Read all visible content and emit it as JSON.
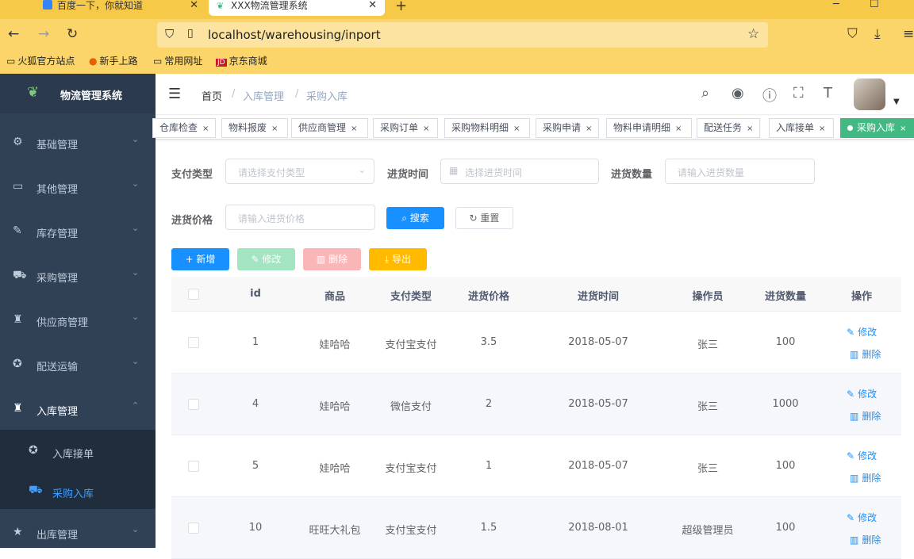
{
  "browser": {
    "tabs": [
      {
        "label": "百度一下，你就知道",
        "close": "✕"
      },
      {
        "label": "XXX物流管理系统",
        "close": "✕"
      }
    ],
    "new_tab": "+",
    "url_host": "localhost",
    "url_path": "/warehousing/inport",
    "bookmarks": [
      "火狐官方站点",
      "新手上路",
      "常用网址",
      "京东商城"
    ]
  },
  "app": {
    "title": "物流管理系统"
  },
  "sidebar": {
    "items": [
      {
        "label": "基础管理",
        "icon": "gear-icon"
      },
      {
        "label": "其他管理",
        "icon": "briefcase-icon"
      },
      {
        "label": "库存管理",
        "icon": "edit-icon"
      },
      {
        "label": "采购管理",
        "icon": "cart-icon"
      },
      {
        "label": "供应商管理",
        "icon": "shirt-icon"
      },
      {
        "label": "配送运输",
        "icon": "wheel-icon"
      },
      {
        "label": "入库管理",
        "icon": "shirt-icon"
      },
      {
        "label": "出库管理",
        "icon": "star-icon"
      }
    ],
    "subitems": [
      {
        "label": "入库接单",
        "icon": "wheel-icon"
      },
      {
        "label": "采购入库",
        "icon": "cart-icon"
      }
    ]
  },
  "breadcrumb": {
    "home": "首页",
    "level2": "入库管理",
    "level3": "采购入库",
    "sep": "/"
  },
  "tags": [
    {
      "label": "仓库检查",
      "active": false
    },
    {
      "label": "物料报废",
      "active": false
    },
    {
      "label": "供应商管理",
      "active": false
    },
    {
      "label": "采购订单",
      "active": false
    },
    {
      "label": "采购物料明细",
      "active": false
    },
    {
      "label": "采购申请",
      "active": false
    },
    {
      "label": "物料申请明细",
      "active": false
    },
    {
      "label": "配送任务",
      "active": false
    },
    {
      "label": "入库接单",
      "active": false
    },
    {
      "label": "采购入库",
      "active": true
    }
  ],
  "tag_close": "×",
  "search_form": {
    "pay_type_label": "支付类型",
    "pay_type_placeholder": "请选择支付类型",
    "purchase_time_label": "进货时间",
    "purchase_time_placeholder": "选择进货时间",
    "quantity_label": "进货数量",
    "quantity_placeholder": "请输入进货数量",
    "price_label": "进货价格",
    "price_placeholder": "请输入进货价格",
    "search_button": "搜索",
    "reset_button": "重置"
  },
  "toolbar": {
    "add": "新增",
    "edit": "修改",
    "delete": "删除",
    "export": "导出"
  },
  "table": {
    "headers": [
      "id",
      "商品",
      "支付类型",
      "进货价格",
      "进货时间",
      "操作员",
      "进货数量",
      "操作"
    ],
    "rows": [
      {
        "id": "1",
        "product": "娃哈哈",
        "pay_type": "支付宝支付",
        "price": "3.5",
        "time": "2018-05-07",
        "operator": "张三",
        "quantity": "100"
      },
      {
        "id": "4",
        "product": "娃哈哈",
        "pay_type": "微信支付",
        "price": "2",
        "time": "2018-05-07",
        "operator": "张三",
        "quantity": "1000"
      },
      {
        "id": "5",
        "product": "娃哈哈",
        "pay_type": "支付宝支付",
        "price": "1",
        "time": "2018-05-07",
        "operator": "张三",
        "quantity": "100"
      },
      {
        "id": "10",
        "product": "旺旺大礼包",
        "pay_type": "支付宝支付",
        "price": "1.5",
        "time": "2018-08-01",
        "operator": "超级管理员",
        "quantity": "100"
      }
    ],
    "op_edit": "修改",
    "op_delete": "删除"
  },
  "colors": {
    "primary": "#1890ff",
    "sidebar_bg": "#304156",
    "tag_active": "#42b983"
  }
}
